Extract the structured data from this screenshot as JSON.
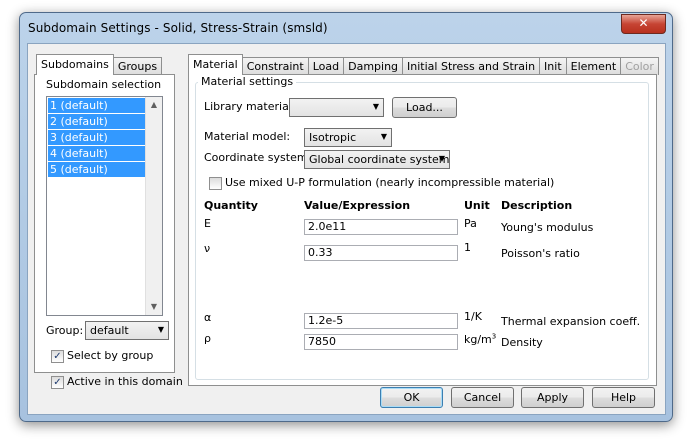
{
  "window": {
    "title": "Subdomain Settings - Solid, Stress-Strain (smsld)",
    "close": "✕"
  },
  "left_tabs": [
    {
      "label": "Subdomains"
    },
    {
      "label": "Groups"
    }
  ],
  "subdomain_selection": {
    "label": "Subdomain selection",
    "items": [
      "1 (default)",
      "2 (default)",
      "3 (default)",
      "4 (default)",
      "5 (default)"
    ]
  },
  "group": {
    "label": "Group:",
    "value": "default"
  },
  "select_by_group": {
    "label": "Select by group",
    "checked": true
  },
  "active_in_domain": {
    "label": "Active in this domain",
    "checked": true
  },
  "right_tabs": [
    {
      "label": "Material"
    },
    {
      "label": "Constraint"
    },
    {
      "label": "Load"
    },
    {
      "label": "Damping"
    },
    {
      "label": "Initial Stress and Strain"
    },
    {
      "label": "Init"
    },
    {
      "label": "Element"
    },
    {
      "label": "Color"
    }
  ],
  "material_settings": {
    "legend": "Material settings",
    "library_material": {
      "label": "Library material:",
      "value": ""
    },
    "load_button": "Load...",
    "material_model": {
      "label": "Material model:",
      "value": "Isotropic"
    },
    "coordinate_system": {
      "label": "Coordinate system:",
      "value": "Global coordinate system"
    },
    "mixed_up": {
      "label": "Use mixed U-P formulation (nearly incompressible material)",
      "checked": false
    }
  },
  "table": {
    "headers": [
      "Quantity",
      "Value/Expression",
      "Unit",
      "Description"
    ],
    "rows": [
      {
        "quantity": "E",
        "value": "2.0e11",
        "unit": "Pa",
        "unit_sup": "",
        "description": "Young's modulus"
      },
      {
        "quantity": "ν",
        "value": "0.33",
        "unit": "1",
        "unit_sup": "",
        "description": "Poisson's ratio"
      },
      {
        "quantity": "α",
        "value": "1.2e-5",
        "unit": "1/K",
        "unit_sup": "",
        "description": "Thermal expansion coeff."
      },
      {
        "quantity": "ρ",
        "value": "7850",
        "unit": "kg/m",
        "unit_sup": "3",
        "description": "Density"
      }
    ]
  },
  "buttons": {
    "ok": "OK",
    "cancel": "Cancel",
    "apply": "Apply",
    "help": "Help"
  },
  "icons": {
    "check": "✓",
    "dropdown": "▼",
    "scroll_up": "▲",
    "scroll_down": "▼"
  }
}
